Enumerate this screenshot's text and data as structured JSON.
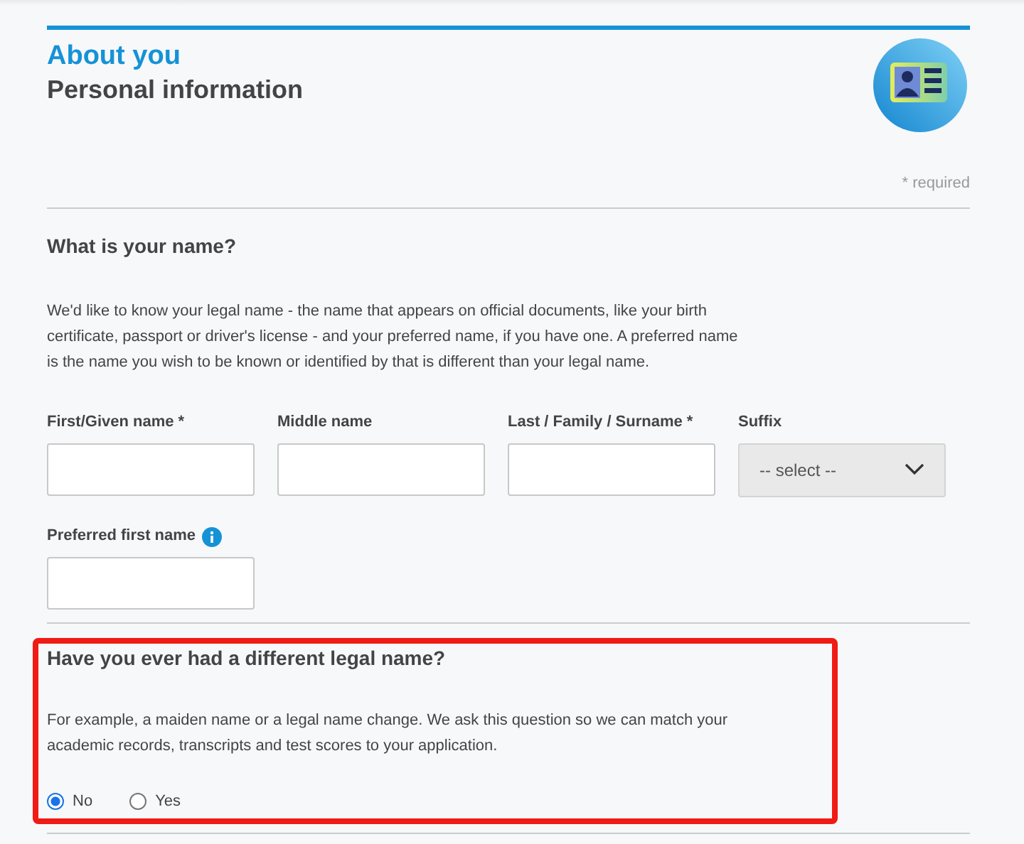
{
  "header": {
    "section": "About you",
    "title": "Personal information",
    "required_note": "* required"
  },
  "name_section": {
    "heading": "What is your name?",
    "description": "We'd like to know your legal name - the name that appears on official documents, like your birth certificate, passport or driver's license - and your preferred name, if you have one. A preferred name is the name you wish to be known or identified by that is different than your legal name.",
    "fields": [
      {
        "kind": "text",
        "label": "First/Given name *"
      },
      {
        "kind": "text",
        "label": "Middle name"
      },
      {
        "kind": "text",
        "label": "Last / Family / Surname *"
      },
      {
        "kind": "select",
        "label": "Suffix",
        "value": "-- select --"
      }
    ],
    "preferred": {
      "label": "Preferred first name",
      "info": true
    }
  },
  "legal_section": {
    "highlighted": true,
    "heading": "Have you ever had a different legal name?",
    "description": "For example, a maiden name or a legal name change. We ask this question so we can match your academic records, transcripts and test scores to your application.",
    "options": [
      {
        "label": "No",
        "selected": true
      },
      {
        "label": "Yes",
        "selected": false
      }
    ]
  }
}
